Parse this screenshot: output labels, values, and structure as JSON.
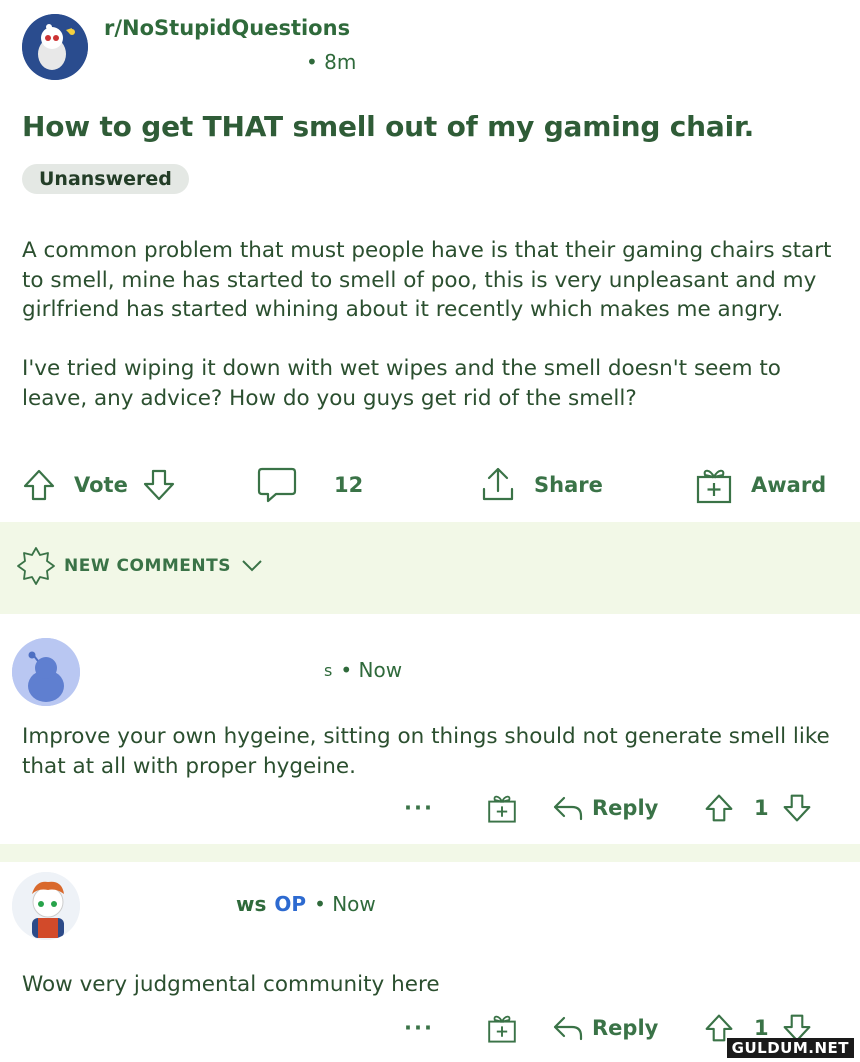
{
  "post": {
    "subreddit": "r/NoStupidQuestions",
    "time": "• 8m",
    "title": "How to get THAT smell out of my gaming chair.",
    "flair": "Unanswered",
    "body": [
      "A common problem that must people have is that their gaming chairs start to smell, mine has started to smell of poo, this is very unpleasant and my girlfriend has started whining about it recently which makes me angry.",
      "I've tried wiping it down with wet wipes and the smell doesn't seem to leave, any advice? How do you guys get rid of the smell?"
    ]
  },
  "actions": {
    "vote_label": "Vote",
    "comment_count": "12",
    "share_label": "Share",
    "award_label": "Award"
  },
  "new_comments": {
    "label": "NEW COMMENTS"
  },
  "comments": [
    {
      "meta_suffix": "s",
      "time": "• Now",
      "body": "Improve your own hygeine, sitting on things should not generate smell like that at all with proper hygeine.",
      "more": "···",
      "reply_label": "Reply",
      "score": "1"
    },
    {
      "meta_suffix": "ws",
      "op_badge": "OP",
      "time": "• Now",
      "body": "Wow very judgmental community here",
      "more": "···",
      "reply_label": "Reply",
      "score": "1"
    }
  ],
  "watermark": "GULDUM.NET",
  "colors": {
    "text_green": "#2b4f2f",
    "accent_green": "#3a7347",
    "band_bg": "#f2f8e7",
    "op_blue": "#2d6ad0"
  }
}
